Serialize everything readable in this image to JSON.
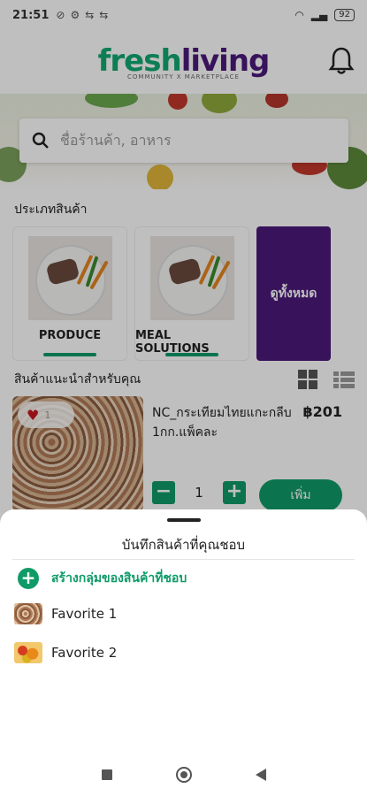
{
  "status_bar": {
    "time": "21:51",
    "battery": "92"
  },
  "header": {
    "logo_part1": "fresh",
    "logo_part2": "living",
    "logo_tagline": "COMMUNITY X MARKETPLACE"
  },
  "search": {
    "placeholder": "ชื่อร้านค้า, อาหาร"
  },
  "categories": {
    "title": "ประเภทสินค้า",
    "items": [
      {
        "label": "PRODUCE"
      },
      {
        "label": "MEAL SOLUTIONS"
      }
    ],
    "view_all": "ดูทั้งหมด"
  },
  "recommended": {
    "title": "สินค้าแนะนำสำหรับคุณ",
    "product": {
      "name": "NC_กระเทียมไทยแกะกลีบ 1กก.แพ็คละ",
      "price": "฿201",
      "like_count": "1",
      "quantity": "1",
      "add_label": "เพิ่ม"
    }
  },
  "sheet": {
    "title": "บันทึกสินค้าที่คุณชอบ",
    "create_label": "สร้างกลุ่มของสินค้าที่ชอบ",
    "favorites": [
      {
        "name": "Favorite 1"
      },
      {
        "name": "Favorite 2"
      }
    ]
  },
  "colors": {
    "brand_green": "#0f9b68",
    "brand_purple": "#4b1a7a"
  }
}
